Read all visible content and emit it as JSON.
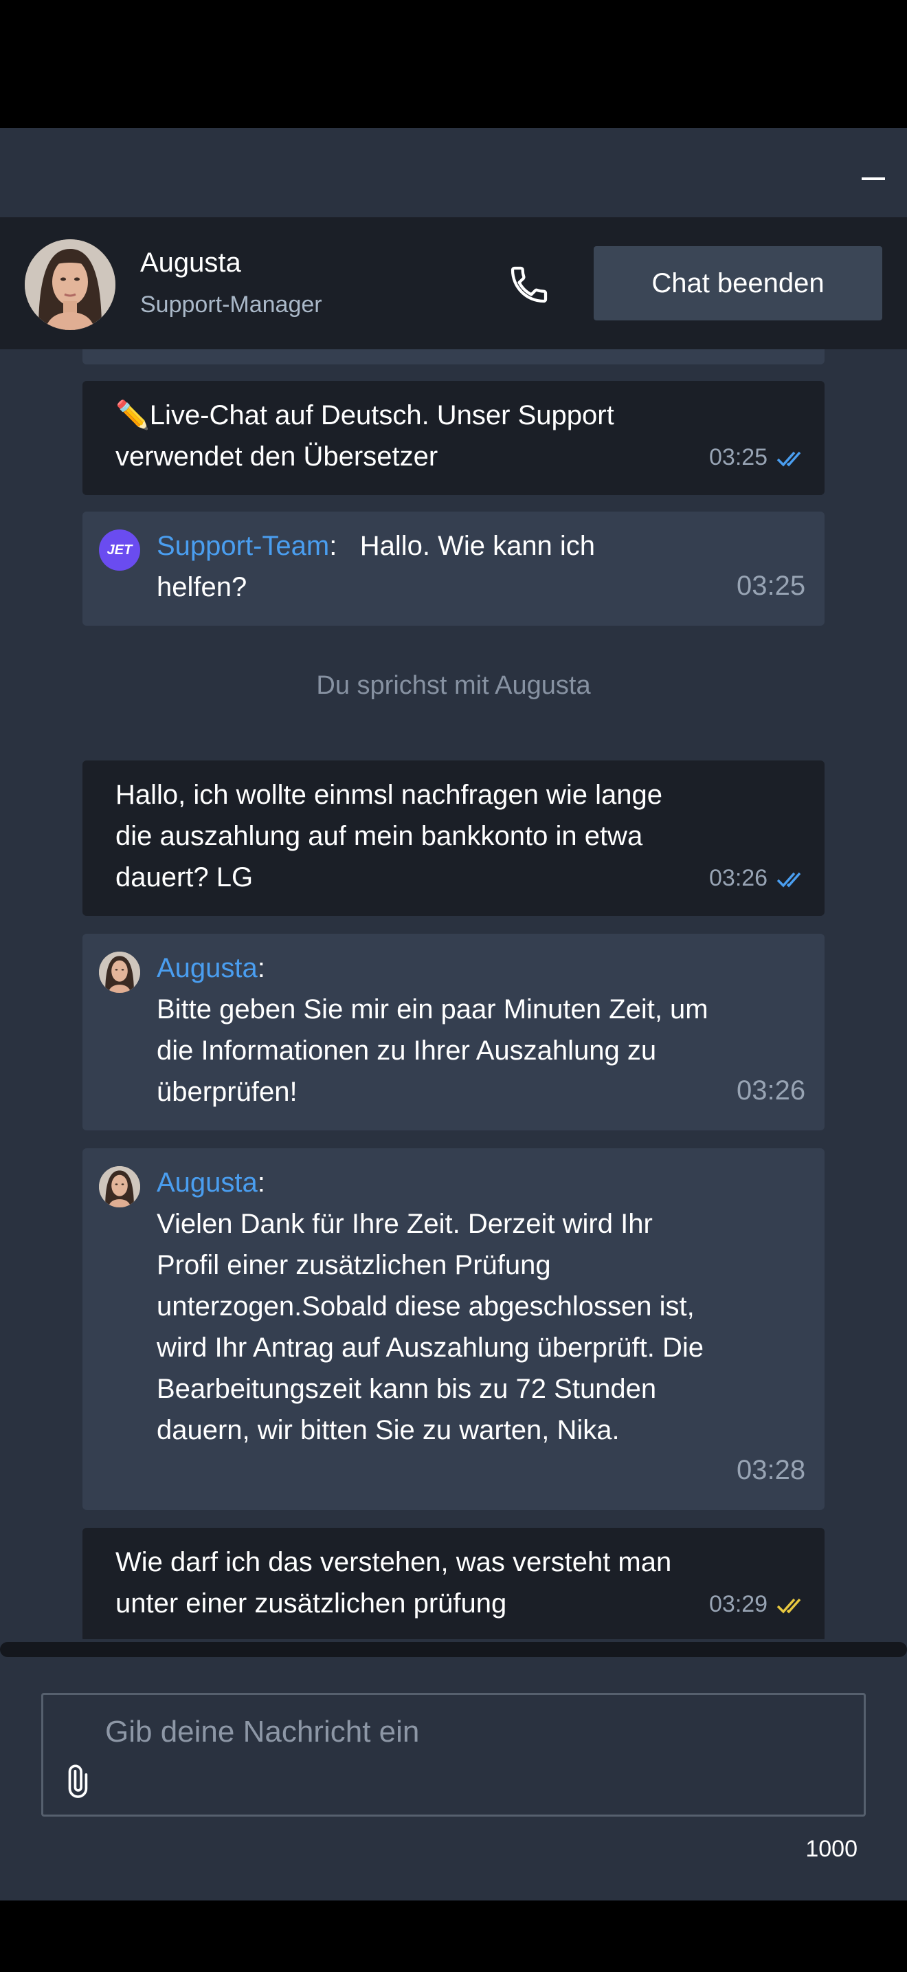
{
  "header": {
    "agent_name": "Augusta",
    "agent_role": "Support-Manager",
    "end_chat_label": "Chat beenden"
  },
  "messages": [
    {
      "type": "user",
      "text": "✏️Live-Chat auf Deutsch. Unser Support verwendet den Übersetzer",
      "time": "03:25",
      "status": "read"
    },
    {
      "type": "agent",
      "sender": "Support-Team",
      "avatar": "jet-logo",
      "text": "Hallo. Wie kann ich helfen?",
      "time": "03:25"
    },
    {
      "type": "agent",
      "sender": "Augusta",
      "avatar": "agent-photo",
      "text": "Bitte geben Sie mir ein paar Minuten Zeit, um die Informationen zu Ihrer Auszahlung zu überprüfen!",
      "time": "03:26"
    },
    {
      "type": "agent",
      "sender": "Augusta",
      "avatar": "agent-photo",
      "text": "Vielen Dank für Ihre Zeit. Derzeit wird Ihr Profil einer zusätzlichen Prüfung unterzogen.Sobald diese abgeschlossen ist, wird Ihr Antrag auf Auszahlung überprüft. Die Bearbeitungszeit kann bis zu 72 Stunden dauern, wir bitten Sie zu warten, Nika.",
      "time": "03:28"
    }
  ],
  "user_messages": {
    "m2": {
      "text": "Hallo, ich wollte einmsl nachfragen wie lange die auszahlung auf mein bankkonto in etwa dauert? LG",
      "time": "03:26",
      "status": "read"
    },
    "m3": {
      "text": "Wie darf ich das verstehen, was versteht man unter einer zusätzlichen prüfung",
      "time": "03:29",
      "status": "delivered"
    }
  },
  "system_note": "Du sprichst mit Augusta",
  "jet_logo_text": "JET",
  "input": {
    "placeholder": "Gib deine Nachricht ein",
    "char_limit": "1000"
  },
  "colors": {
    "background": "#2a3240",
    "header": "#1b1f27",
    "user_bubble": "#1b1f27",
    "agent_bubble": "#353f50",
    "sender_name": "#4a9ef0",
    "read_ticks": "#4a9ef0",
    "delivered_ticks": "#e8c840",
    "end_button": "#3b4656"
  },
  "icons": [
    "minimize-icon",
    "phone-icon",
    "double-check-icon",
    "paperclip-icon"
  ]
}
